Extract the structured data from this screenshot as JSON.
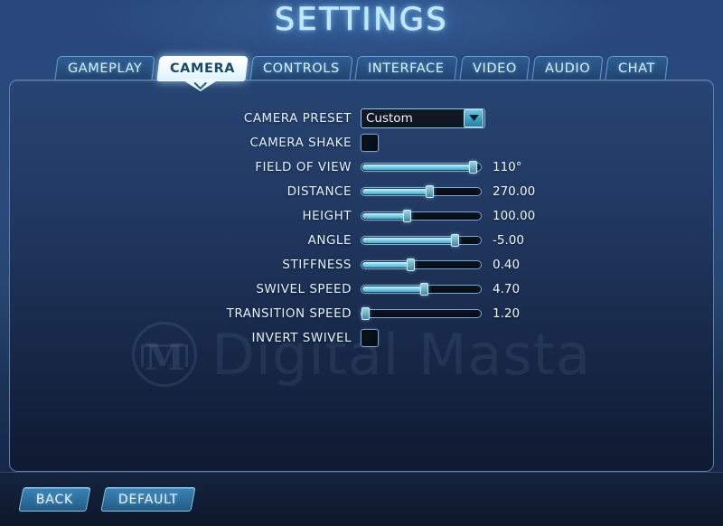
{
  "header": {
    "title": "SETTINGS"
  },
  "tabs": [
    {
      "label": "GAMEPLAY",
      "active": false
    },
    {
      "label": "CAMERA",
      "active": true
    },
    {
      "label": "CONTROLS",
      "active": false
    },
    {
      "label": "INTERFACE",
      "active": false
    },
    {
      "label": "VIDEO",
      "active": false
    },
    {
      "label": "AUDIO",
      "active": false
    },
    {
      "label": "CHAT",
      "active": false
    }
  ],
  "settings": [
    {
      "label": "CAMERA PRESET",
      "type": "dropdown",
      "value": "Custom",
      "icon": "chevron-down-icon"
    },
    {
      "label": "CAMERA SHAKE",
      "type": "checkbox",
      "checked": false
    },
    {
      "label": "FIELD OF VIEW",
      "type": "slider",
      "value": "110°",
      "percent": 93
    },
    {
      "label": "DISTANCE",
      "type": "slider",
      "value": "270.00",
      "percent": 57
    },
    {
      "label": "HEIGHT",
      "type": "slider",
      "value": "100.00",
      "percent": 38
    },
    {
      "label": "ANGLE",
      "type": "slider",
      "value": "-5.00",
      "percent": 78
    },
    {
      "label": "STIFFNESS",
      "type": "slider",
      "value": "0.40",
      "percent": 41
    },
    {
      "label": "SWIVEL SPEED",
      "type": "slider",
      "value": "4.70",
      "percent": 52
    },
    {
      "label": "TRANSITION SPEED",
      "type": "slider",
      "value": "1.20",
      "percent": 3
    },
    {
      "label": "INVERT SWIVEL",
      "type": "checkbox",
      "checked": false
    }
  ],
  "watermark": {
    "text": "Digital Masta",
    "logo_letter": "M"
  },
  "footer": {
    "back_label": "BACK",
    "default_label": "DEFAULT"
  },
  "colors": {
    "accent": "#7fd3ee",
    "title_glow": "#bfe6ff",
    "panel_border": "#567fb4",
    "active_tab_bg": "#ffffff",
    "active_tab_text": "#1d4a63",
    "button_blue": "#2f6fa0"
  }
}
